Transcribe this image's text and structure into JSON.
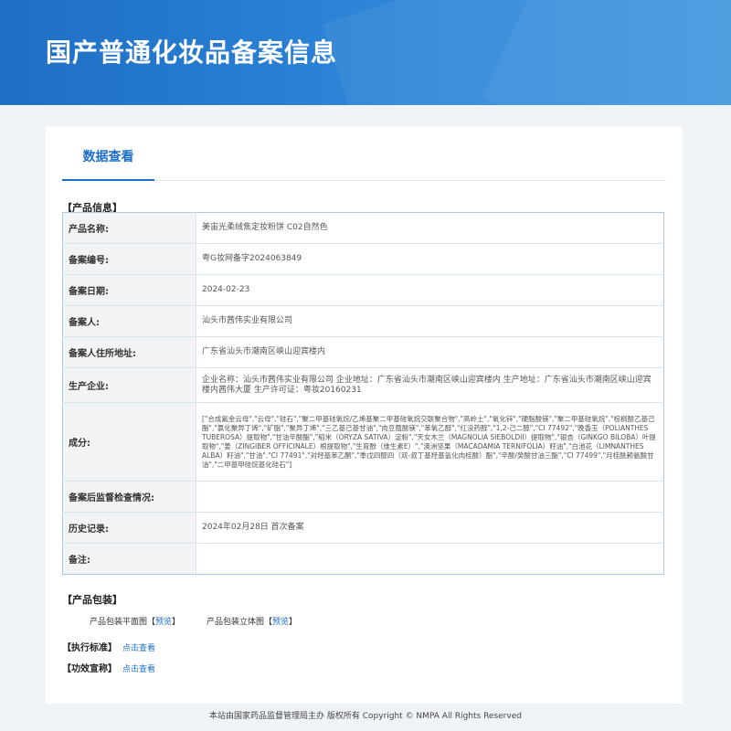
{
  "banner": {
    "title": "国产普通化妆品备案信息"
  },
  "tab": {
    "label": "数据查看"
  },
  "product_info": {
    "section_title": "【产品信息】",
    "rows": [
      {
        "label": "产品名称:",
        "value": "美宙光柔绒焦定妆粉饼 C02自然色"
      },
      {
        "label": "备案编号:",
        "value": "粤G妆网备字2024063849"
      },
      {
        "label": "备案日期:",
        "value": "2024-02-23"
      },
      {
        "label": "备案人:",
        "value": "汕头市茜伟实业有限公司"
      },
      {
        "label": "备案人住所地址:",
        "value": "广东省汕头市潮南区峡山迎宾楼内"
      },
      {
        "label": "生产企业:",
        "value": "企业名称：汕头市茜伟实业有限公司 企业地址：广东省汕头市潮南区峡山迎宾楼内 生产地址：广东省汕头市潮南区峡山迎宾楼内茜伟大厦 生产许可证：粤妆20160231"
      },
      {
        "label": "成分:",
        "value": "[\"合成氟金云母\",\"云母\",\"硅石\",\"聚二甲基硅氧烷/乙烯基聚二甲基硅氧烷交联聚合物\",\"高岭土\",\"氧化锌\",\"硬脂酸镁\",\"聚二甲基硅氧烷\",\"棕榈酸乙基己酯\",\"氯化聚异丁烯\",\"矿脂\",\"聚异丁烯\",\"三乙基己基甘油\",\"肉豆蔻酸镁\",\"苯氧乙醇\",\"红没药醇\",\"1,2-己二醇\",\"CI 77492\",\"晚香玉（POLIANTHES TUBEROSA）提取物\",\"甘油辛酸酯\",\"稻米（ORYZA SATIVA）淀粉\",\"天女木兰（MAGNOLIA SIEBOLDII）提取物\",\"银杏（GINKGO BILOBA）叶提取物\",\"姜（ZINGIBER OFFICINALE）根提取物\",\"生育酚（维生素E）\",\"澳洲坚果（MACADAMIA TERNIFOLIA）籽油\",\"白池花（LIMNANTHES ALBA）籽油\",\"甘油\",\"CI 77491\",\"对羟基苯乙酮\",\"季戊四醇四（双-叔丁基羟基氢化肉桂酸）酯\",\"辛酸/癸酸甘油三酯\",\"CI 77499\",\"月桂酰赖氨酸甘油\",\"二甲基甲硅烷基化硅石\"]"
      },
      {
        "label": "备案后监督检查情况:",
        "value": ""
      },
      {
        "label": "历史记录:",
        "value": "2024年02月28日 首次备案"
      },
      {
        "label": "备注:",
        "value": ""
      }
    ]
  },
  "packaging": {
    "section_title": "【产品包装】",
    "items": [
      {
        "label": "产品包装平面图",
        "link": "预览"
      },
      {
        "label": "产品包装立体图",
        "link": "预览"
      }
    ]
  },
  "standard": {
    "section_title": "【执行标准】",
    "link": "点击查看"
  },
  "efficacy": {
    "section_title": "【功效宣称】",
    "link": "点击查看"
  },
  "footer": {
    "text": "本站由国家药品监督管理局主办 版权所有 Copyright © NMPA All Rights Reserved"
  },
  "colors": {
    "banner": "#2f86d8",
    "accent": "#1e6fc9",
    "table_border": "#aac8e4"
  }
}
